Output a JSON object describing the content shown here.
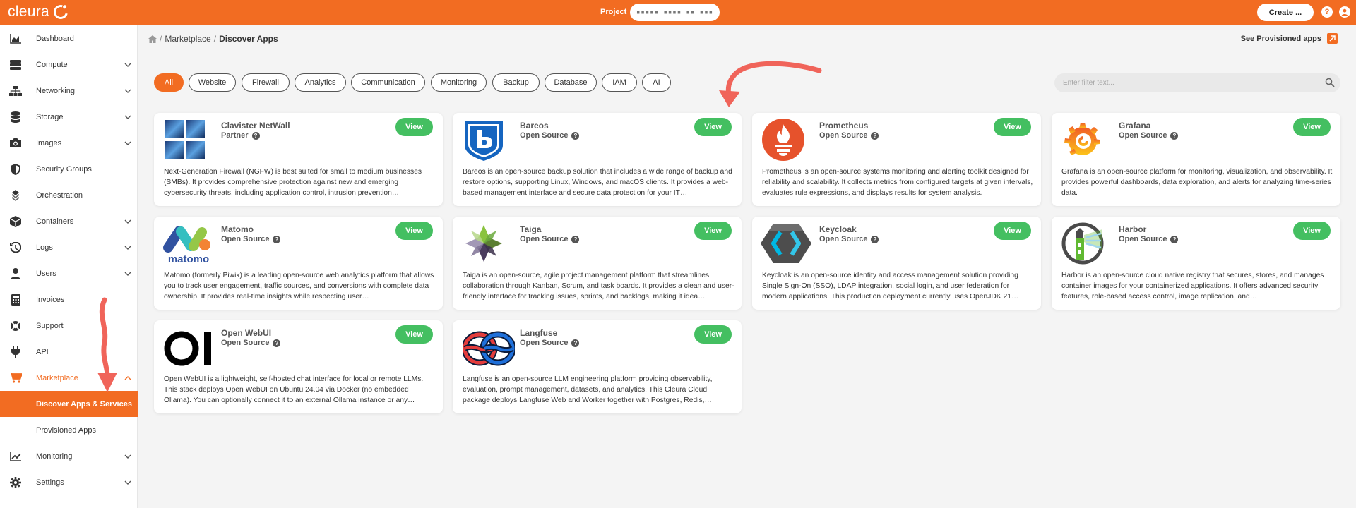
{
  "topbar": {
    "logo_text": "cleura",
    "project_label": "Project",
    "project_value": "▪▪▪▪▪ ▪▪▪▪ ▪▪ ▪▪▪",
    "create_label": "Create ...",
    "help_icon": "question-circle-icon",
    "user_icon": "user-circle-icon",
    "brand_color": "#f26c22"
  },
  "sidebar": {
    "items": [
      {
        "label": "Dashboard",
        "icon": "chart-area-icon"
      },
      {
        "label": "Compute",
        "icon": "server-icon"
      },
      {
        "label": "Networking",
        "icon": "network-icon"
      },
      {
        "label": "Storage",
        "icon": "database-icon"
      },
      {
        "label": "Images",
        "icon": "camera-icon"
      },
      {
        "label": "Security Groups",
        "icon": "shield-icon"
      },
      {
        "label": "Orchestration",
        "icon": "layers-icon"
      },
      {
        "label": "Containers",
        "icon": "cube-icon"
      },
      {
        "label": "Logs",
        "icon": "history-icon"
      },
      {
        "label": "Users",
        "icon": "user-icon"
      },
      {
        "label": "Invoices",
        "icon": "calculator-icon"
      },
      {
        "label": "Support",
        "icon": "lifebuoy-icon"
      },
      {
        "label": "API",
        "icon": "plug-icon"
      },
      {
        "label": "Marketplace",
        "icon": "cart-icon"
      },
      {
        "label": "Monitoring",
        "icon": "chart-line-icon"
      },
      {
        "label": "Settings",
        "icon": "gear-icon"
      }
    ],
    "marketplace_sub": [
      "Discover Apps & Services",
      "Provisioned Apps"
    ]
  },
  "breadcrumb": {
    "home_icon": "home-icon",
    "items": [
      "Marketplace",
      "Discover Apps"
    ],
    "see_provisioned": "See Provisioned apps"
  },
  "filters": [
    "All",
    "Website",
    "Firewall",
    "Analytics",
    "Communication",
    "Monitoring",
    "Backup",
    "Database",
    "IAM",
    "AI"
  ],
  "search": {
    "placeholder": "Enter filter text..."
  },
  "apps": [
    {
      "name": "Clavister NetWall",
      "tag": "Partner",
      "view": "View",
      "desc": "Next-Generation Firewall (NGFW) is best suited for small to medium businesses (SMBs). It provides comprehensive protection against new and emerging cybersecurity threats, including application control, intrusion prevention…"
    },
    {
      "name": "Bareos",
      "tag": "Open Source",
      "view": "View",
      "desc": "Bareos is an open-source backup solution that includes a wide range of backup and restore options, supporting Linux, Windows, and macOS clients. It provides a web-based management interface and secure data protection for your IT…"
    },
    {
      "name": "Prometheus",
      "tag": "Open Source",
      "view": "View",
      "desc": "Prometheus is an open-source systems monitoring and alerting toolkit designed for reliability and scalability. It collects metrics from configured targets at given intervals, evaluates rule expressions, and displays results for system analysis."
    },
    {
      "name": "Grafana",
      "tag": "Open Source",
      "view": "View",
      "desc": "Grafana is an open-source platform for monitoring, visualization, and observability. It provides powerful dashboards, data exploration, and alerts for analyzing time-series data."
    },
    {
      "name": "Matomo",
      "tag": "Open Source",
      "view": "View",
      "logo_text": "matomo",
      "desc": "Matomo (formerly Piwik) is a leading open-source web analytics platform that allows you to track user engagement, traffic sources, and conversions with complete data ownership. It provides real-time insights while respecting user…"
    },
    {
      "name": "Taiga",
      "tag": "Open Source",
      "view": "View",
      "desc": "Taiga is an open-source, agile project management platform that streamlines collaboration through Kanban, Scrum, and task boards. It provides a clean and user-friendly interface for tracking issues, sprints, and backlogs, making it idea…"
    },
    {
      "name": "Keycloak",
      "tag": "Open Source",
      "view": "View",
      "desc": "Keycloak is an open-source identity and access management solution providing Single Sign-On (SSO), LDAP integration, social login, and user federation for modern applications. This production deployment currently uses OpenJDK 21…"
    },
    {
      "name": "Harbor",
      "tag": "Open Source",
      "view": "View",
      "desc": "Harbor is an open-source cloud native registry that secures, stores, and manages container images for your containerized applications. It offers advanced security features, role-based access control, image replication, and…"
    },
    {
      "name": "Open WebUI",
      "tag": "Open Source",
      "view": "View",
      "desc": "Open WebUI is a lightweight, self-hosted chat interface for local or remote LLMs. This stack deploys Open WebUI on Ubuntu 24.04 via Docker (no embedded Ollama). You can optionally connect it to an external Ollama instance or any…"
    },
    {
      "name": "Langfuse",
      "tag": "Open Source",
      "view": "View",
      "desc": "Langfuse is an open-source LLM engineering platform providing observability, evaluation, prompt management, datasets, and analytics. This Cleura Cloud package deploys Langfuse Web and Worker together with Postgres, Redis,…"
    }
  ],
  "colors": {
    "accent": "#f26c22",
    "view_button": "#44bf61",
    "annotation_arrow": "#f0645a"
  }
}
